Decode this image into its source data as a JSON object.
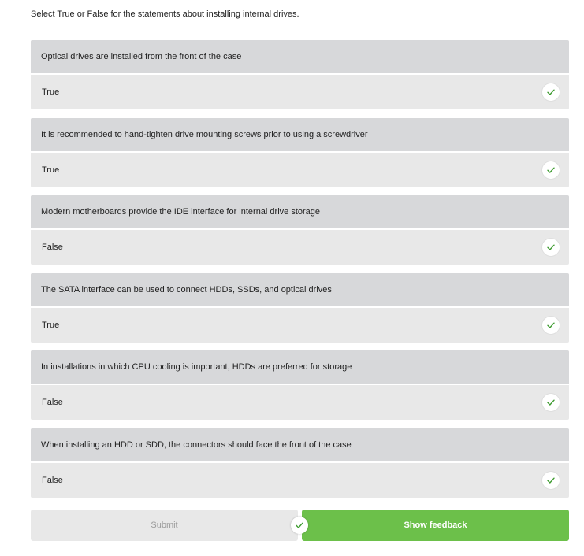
{
  "instructions": "Select True or False for the statements about installing internal drives.",
  "colors": {
    "question_bg": "#d7d8da",
    "answer_bg": "#e8e8e8",
    "check_green": "#3d9b2f",
    "primary_button": "#6cc04a",
    "disabled_button": "#e8e8e8"
  },
  "questions": [
    {
      "statement": "Optical drives are installed from the front of the case",
      "answer": "True",
      "status_icon": "check-icon"
    },
    {
      "statement": "It is recommended to hand-tighten drive mounting screws prior to using a screwdriver",
      "answer": "True",
      "status_icon": "check-icon"
    },
    {
      "statement": "Modern motherboards provide the IDE interface for internal drive storage",
      "answer": "False",
      "status_icon": "check-icon"
    },
    {
      "statement": "The SATA interface can be used to connect HDDs, SSDs, and optical drives",
      "answer": "True",
      "status_icon": "check-icon"
    },
    {
      "statement": "In installations in which CPU cooling is important, HDDs are preferred for storage",
      "answer": "False",
      "status_icon": "check-icon"
    },
    {
      "statement": "When installing an HDD or SDD, the connectors should face the front of the case",
      "answer": "False",
      "status_icon": "check-icon"
    }
  ],
  "footer": {
    "submit_label": "Submit",
    "feedback_label": "Show feedback",
    "status_icon": "check-icon"
  }
}
